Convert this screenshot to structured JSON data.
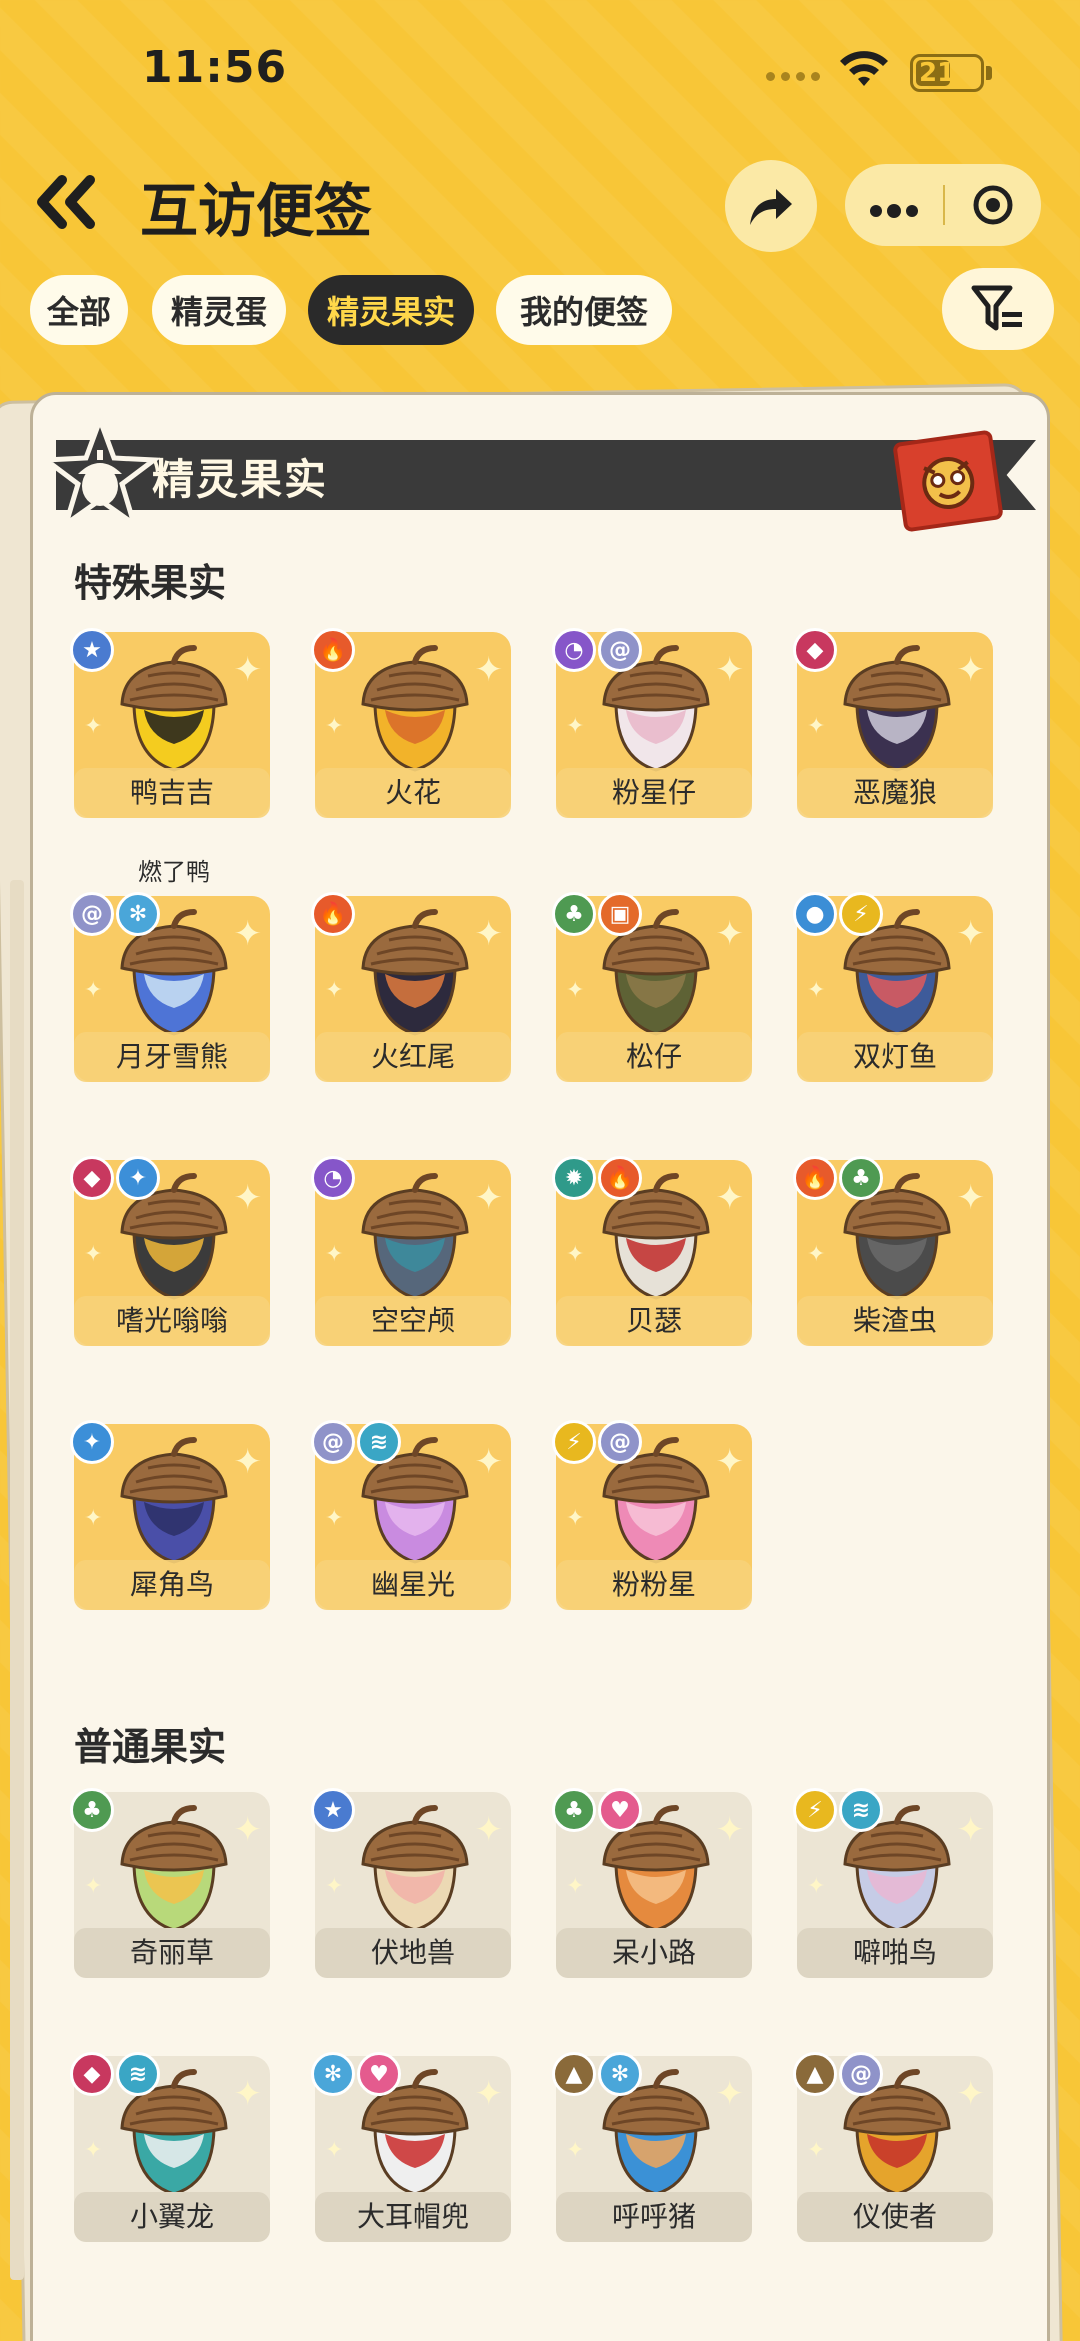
{
  "status": {
    "time": "11:56",
    "battery": "21"
  },
  "header": {
    "title": "互访便签"
  },
  "tabs": [
    {
      "label": "全部",
      "active": false
    },
    {
      "label": "精灵蛋",
      "active": false
    },
    {
      "label": "精灵果实",
      "active": true
    },
    {
      "label": "我的便签",
      "active": false
    }
  ],
  "banner": {
    "title": "精灵果实"
  },
  "sections": {
    "special": {
      "title": "特殊果实",
      "items": [
        {
          "name": "鸭吉吉",
          "sub": "燃了鸭",
          "badges": [
            "star"
          ],
          "colors": [
            "#f4cc1f",
            "#1d1d1d"
          ]
        },
        {
          "name": "火花",
          "badges": [
            "fire"
          ],
          "colors": [
            "#f2b32a",
            "#d8682a"
          ]
        },
        {
          "name": "粉星仔",
          "badges": [
            "ghost",
            "swirl"
          ],
          "colors": [
            "#f1e6ea",
            "#e9b6c9"
          ]
        },
        {
          "name": "恶魔狼",
          "badges": [
            "demon"
          ],
          "colors": [
            "#3b3150",
            "#cfcbd9"
          ]
        },
        {
          "name": "月牙雪熊",
          "badges": [
            "swirl",
            "ice"
          ],
          "colors": [
            "#4e74d6",
            "#cde3f5"
          ]
        },
        {
          "name": "火红尾",
          "badges": [
            "fire"
          ],
          "colors": [
            "#2d2a3d",
            "#e07a3d"
          ]
        },
        {
          "name": "松仔",
          "badges": [
            "grass",
            "stump"
          ],
          "colors": [
            "#5e6235",
            "#8d7a49"
          ]
        },
        {
          "name": "双灯鱼",
          "badges": [
            "water",
            "electric"
          ],
          "colors": [
            "#3e5b9a",
            "#e05a5a"
          ]
        },
        {
          "name": "嗜光嗡嗡",
          "badges": [
            "demon",
            "light"
          ],
          "colors": [
            "#3b3b3b",
            "#f0b93a"
          ]
        },
        {
          "name": "空空颅",
          "badges": [
            "ghost"
          ],
          "colors": [
            "#56677b",
            "#3a8ea0"
          ]
        },
        {
          "name": "贝瑟",
          "badges": [
            "gear",
            "fire"
          ],
          "colors": [
            "#e6e1d7",
            "#c02a2a"
          ]
        },
        {
          "name": "柴渣虫",
          "badges": [
            "fire",
            "grass"
          ],
          "colors": [
            "#4b4b4b",
            "#6a6a6a"
          ]
        },
        {
          "name": "犀角鸟",
          "badges": [
            "light"
          ],
          "colors": [
            "#4a4fa8",
            "#2b2f66"
          ]
        },
        {
          "name": "幽星光",
          "badges": [
            "swirl",
            "wing"
          ],
          "colors": [
            "#c98be0",
            "#e8b8ef"
          ]
        },
        {
          "name": "粉粉星",
          "badges": [
            "electric",
            "swirl"
          ],
          "colors": [
            "#ee8ab6",
            "#f7c3d8"
          ]
        }
      ]
    },
    "normal": {
      "title": "普通果实",
      "items": [
        {
          "name": "奇丽草",
          "badges": [
            "grass"
          ],
          "colors": [
            "#b8d97a",
            "#f3c14a"
          ]
        },
        {
          "name": "伏地兽",
          "badges": [
            "star"
          ],
          "colors": [
            "#ecd9b4",
            "#f2b0a8"
          ]
        },
        {
          "name": "呆小路",
          "badges": [
            "grass",
            "heart"
          ],
          "colors": [
            "#e58a3e",
            "#f6c18a"
          ]
        },
        {
          "name": "噼啪鸟",
          "badges": [
            "electric",
            "wing"
          ],
          "colors": [
            "#c6cce6",
            "#e9b6d2"
          ]
        },
        {
          "name": "小翼龙",
          "badges": [
            "demon",
            "wing"
          ],
          "colors": [
            "#3aa8a5",
            "#f2f2f2"
          ]
        },
        {
          "name": "大耳帽兜",
          "badges": [
            "ice",
            "heart"
          ],
          "colors": [
            "#efefef",
            "#c92a2a"
          ]
        },
        {
          "name": "呼呼猪",
          "badges": [
            "mountain",
            "ice"
          ],
          "colors": [
            "#3b91d6",
            "#f2a65a"
          ]
        },
        {
          "name": "仪使者",
          "badges": [
            "mountain",
            "swirl"
          ],
          "colors": [
            "#e5a42c",
            "#c5302a"
          ]
        }
      ]
    }
  },
  "badge_types": {
    "star": {
      "color": "#4a7bd0",
      "glyph": "★"
    },
    "fire": {
      "color": "#e75a2b",
      "glyph": "🔥"
    },
    "ghost": {
      "color": "#8656c9",
      "glyph": "◔"
    },
    "swirl": {
      "color": "#8f93c9",
      "glyph": "@"
    },
    "demon": {
      "color": "#c8385f",
      "glyph": "◆"
    },
    "ice": {
      "color": "#4aa6d9",
      "glyph": "✻"
    },
    "grass": {
      "color": "#4f9a52",
      "glyph": "♣"
    },
    "stump": {
      "color": "#e46a2a",
      "glyph": "▣"
    },
    "water": {
      "color": "#3b8ed6",
      "glyph": "●"
    },
    "electric": {
      "color": "#e8b81f",
      "glyph": "⚡"
    },
    "light": {
      "color": "#3c8fd8",
      "glyph": "✦"
    },
    "gear": {
      "color": "#2f9a8a",
      "glyph": "✹"
    },
    "wing": {
      "color": "#3aa6c5",
      "glyph": "≋"
    },
    "heart": {
      "color": "#e45b8e",
      "glyph": "♥"
    },
    "mountain": {
      "color": "#8a6a3a",
      "glyph": "▲"
    }
  }
}
